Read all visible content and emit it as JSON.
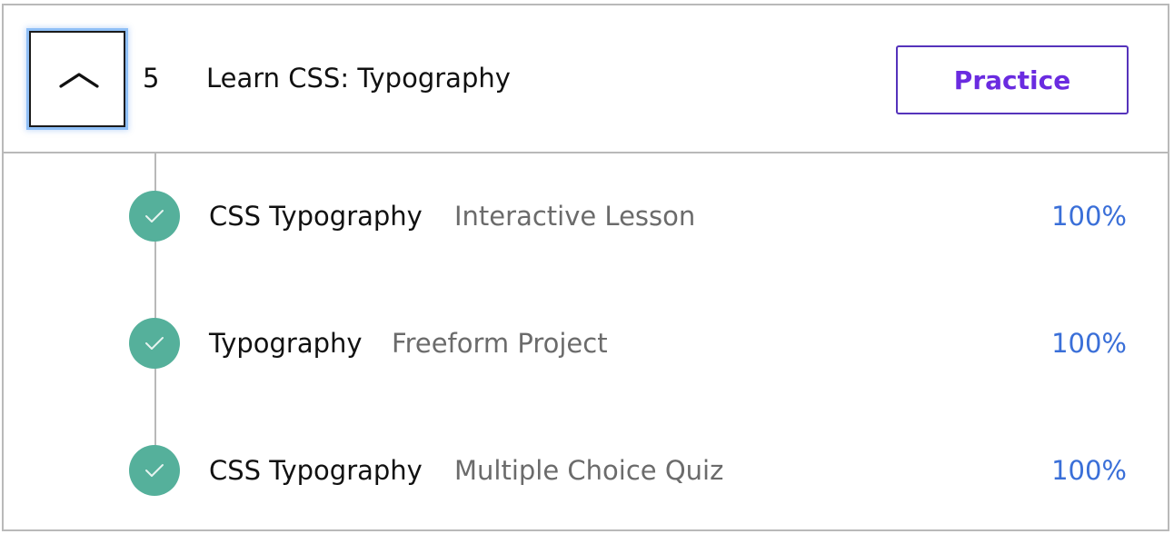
{
  "module": {
    "number": "5",
    "title": "Learn CSS: Typography",
    "toggle_icon": "chevron-up-icon",
    "practice_label": "Practice",
    "colors": {
      "practice_text": "#6a2be0",
      "practice_border": "#5533bb",
      "focus_ring": "#8fbff6"
    }
  },
  "items": [
    {
      "title": "CSS Typography",
      "type": "Interactive Lesson",
      "progress": "100%",
      "status_icon": "check-circle-icon",
      "completed": true
    },
    {
      "title": "Typography",
      "type": "Freeform Project",
      "progress": "100%",
      "status_icon": "check-circle-icon",
      "completed": true
    },
    {
      "title": "CSS Typography",
      "type": "Multiple Choice Quiz",
      "progress": "100%",
      "status_icon": "check-circle-icon",
      "completed": true
    }
  ],
  "colors": {
    "complete_green": "#55b09b",
    "progress_blue": "#3a6fd8",
    "muted_text": "#6b6b6b"
  }
}
